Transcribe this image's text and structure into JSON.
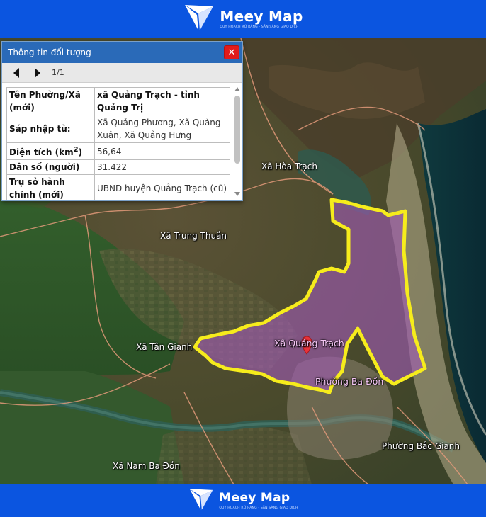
{
  "brand": {
    "name": "Meey Map",
    "tagline": "QUY HOẠCH RÕ RÀNG - SẴN SÀNG GIAO DỊCH"
  },
  "popup": {
    "title": "Thông tin đối tượng",
    "close_symbol": "✕",
    "pager": "1/1",
    "rows": [
      {
        "key": "Tên Phường/Xã (mới)",
        "value": "xã Quảng Trạch - tỉnh Quảng Trị"
      },
      {
        "key": "Sáp nhập từ:",
        "value": "Xã Quảng Phương, Xã Quảng Xuân, Xã Quảng Hưng"
      },
      {
        "key_main": "Diện tích (km",
        "key_sup": "2",
        "key_end": ")",
        "value": "56,64"
      },
      {
        "key": "Dân số (người)",
        "value": "31.422"
      },
      {
        "key": "Trụ sở hành chính (mới)",
        "value": "UBND huyện Quảng Trạch (cũ)"
      }
    ]
  },
  "map": {
    "labels": [
      {
        "name": "Xã Hòa Trạch"
      },
      {
        "name": "Xã Trung Thuần"
      },
      {
        "name": "Xã Quảng Trạch"
      },
      {
        "name": "Xã Tân Gianh"
      },
      {
        "name": "Phường Ba Đồn"
      },
      {
        "name": "Phường Bắc Gianh"
      },
      {
        "name": "Xã Nam Ba Đồn"
      }
    ],
    "highlight_color": "#f6ec1c",
    "highlight_fill": "#a05ab4",
    "marker_color": "#e8323a"
  },
  "icons": {
    "logo": "meey-logo-icon",
    "prev": "arrow-left-icon",
    "next": "arrow-right-icon",
    "close": "close-icon",
    "marker": "map-pin-icon"
  }
}
